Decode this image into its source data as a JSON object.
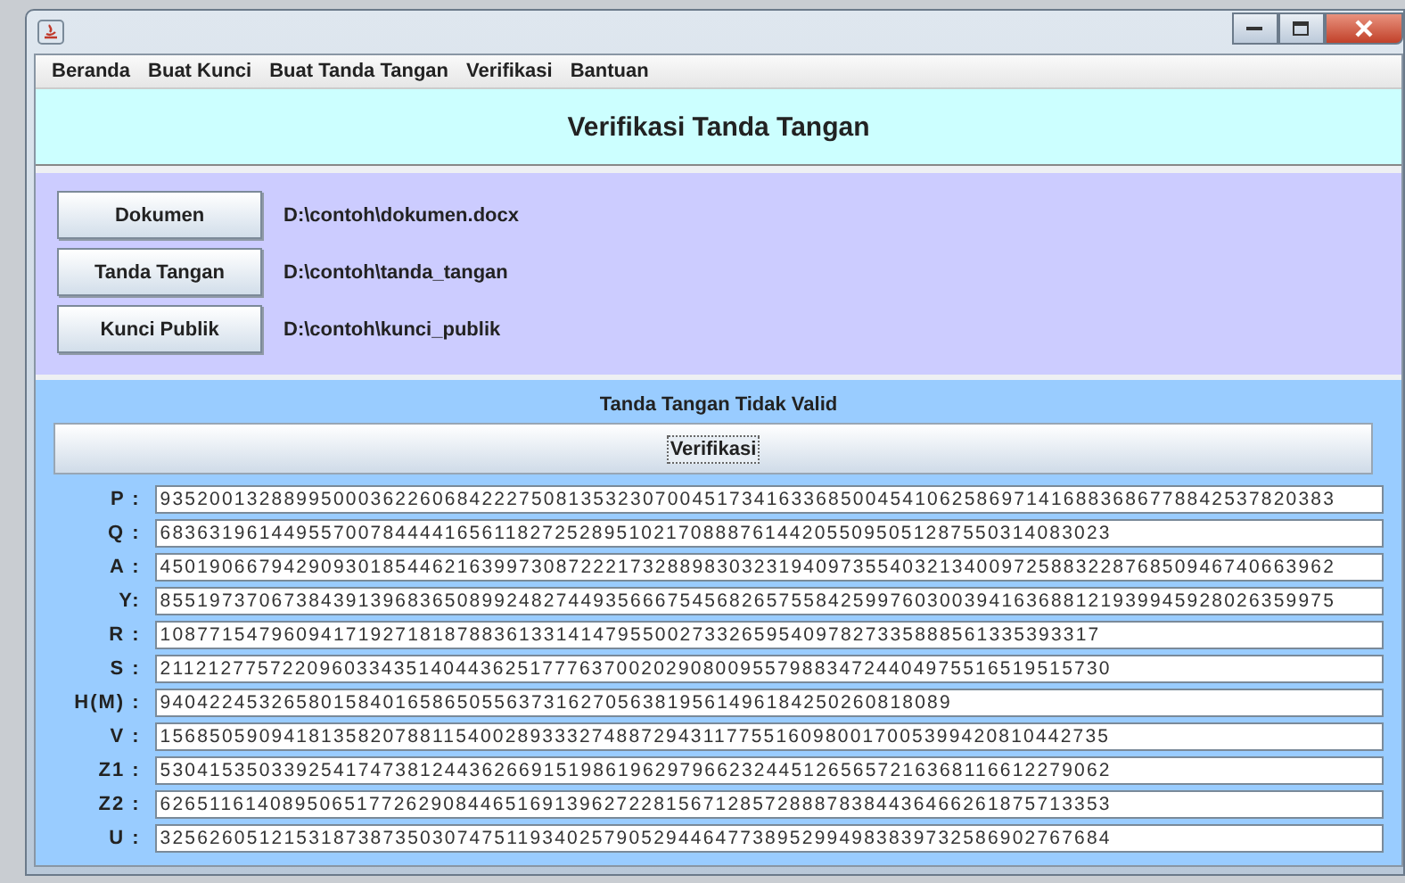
{
  "menu": [
    "Beranda",
    "Buat Kunci",
    "Buat Tanda Tangan",
    "Verifikasi",
    "Bantuan"
  ],
  "heading": "Verifikasi Tanda Tangan",
  "files": [
    {
      "button": "Dokumen",
      "path": "D:\\contoh\\dokumen.docx"
    },
    {
      "button": "Tanda Tangan",
      "path": "D:\\contoh\\tanda_tangan"
    },
    {
      "button": "Kunci Publik",
      "path": "D:\\contoh\\kunci_publik"
    }
  ],
  "status": "Tanda Tangan Tidak Valid",
  "verify_button": "Verifikasi",
  "fields": [
    {
      "label": "P :",
      "value": "93520013288995000362260684222750813532307004517341633685004541062586971416883686778842537820383"
    },
    {
      "label": "Q :",
      "value": "68363196144955700784444165611827252895102170888761442055095051287550314083023"
    },
    {
      "label": "A :",
      "value": "45019066794290930185446216399730872221732889830323194097355403213400972588322876850946740663962"
    },
    {
      "label": "Y:",
      "value": "85519737067384391396836508992482744935666754568265755842599760300394163688121939945928026359975"
    },
    {
      "label": "R :",
      "value": "1087715479609417192718187883613314147955002733265954097827335888561335393317"
    },
    {
      "label": "S :",
      "value": "21121277572209603343514044362517776370020290800955798834724404975516519515730"
    },
    {
      "label": "H(M) :",
      "value": "9404224532658015840165865055637316270563819561496184250260818089"
    },
    {
      "label": "V :",
      "value": "15685059094181358207881154002893332748872943117755160980017005399420810442735"
    },
    {
      "label": "Z1 :",
      "value": "53041535033925417473812443626691519861962979662324451265657216368116612279062"
    },
    {
      "label": "Z2 :",
      "value": "62651161408950651772629084465169139627228156712857288878384436466261875713353"
    },
    {
      "label": "U :",
      "value": "32562605121531873873503074751193402579052944647738952994983839732586902767684"
    }
  ]
}
